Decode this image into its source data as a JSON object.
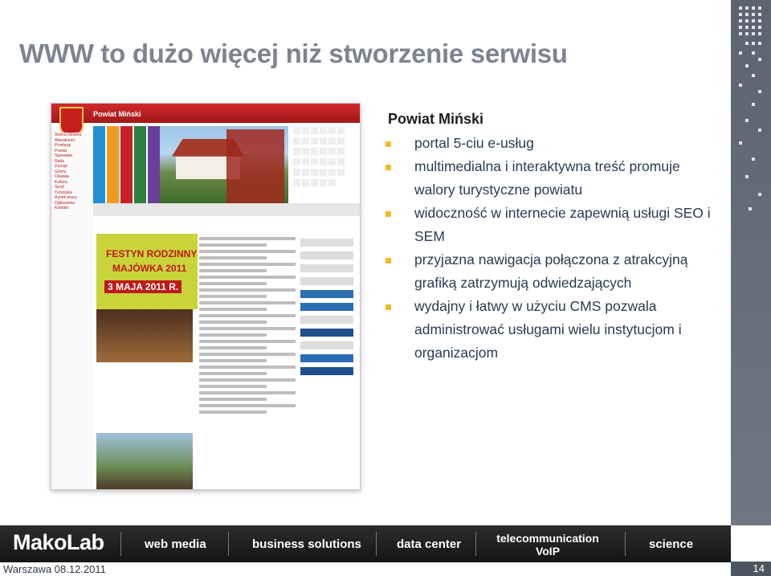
{
  "slide": {
    "title": "WWW to dużo więcej niż stworzenie serwisu",
    "heading": "Powiat Miński",
    "bullets": [
      "portal 5-ciu e-usług",
      "multimedialna i interaktywna treść promuje walory turystyczne powiatu",
      "widoczność w internecie zapewnią usługi SEO i SEM",
      "przyjazna nawigacja połączona z atrakcyjną grafiką zatrzymują odwiedzających",
      "wydajny i łatwy w użyciu CMS pozwala administrować usługami wielu instytucjom i organizacjom"
    ],
    "date": "Warszawa 08.12.2011",
    "page_number": "14"
  },
  "website": {
    "name": "Powiat Miński",
    "festyn": [
      "FESTYN RODZINNY",
      "MAJÓWKA 2011",
      "3 MAJA 2011 R."
    ],
    "sidebar": [
      "Strona Główna",
      "Aktualności",
      "Przetargi",
      "Powiat",
      "Starostwo",
      "Rada",
      "Zarząd",
      "Gminy",
      "Oświata",
      "Kultura",
      "Sport",
      "Turystyka",
      "Rynek pracy",
      "Ogłoszenia",
      "Kontakt"
    ]
  },
  "footer": {
    "logo": "MakoLab",
    "items": [
      "web media",
      "business solutions",
      "data center",
      "science"
    ],
    "telecom_line1": "telecommunication",
    "telecom_line2": "VoIP"
  },
  "colors": {
    "title": "#7c8391",
    "bullet": "#f5b826",
    "text": "#2a3a55",
    "footer": "#1f1f1f",
    "strip": "#6a727e"
  }
}
